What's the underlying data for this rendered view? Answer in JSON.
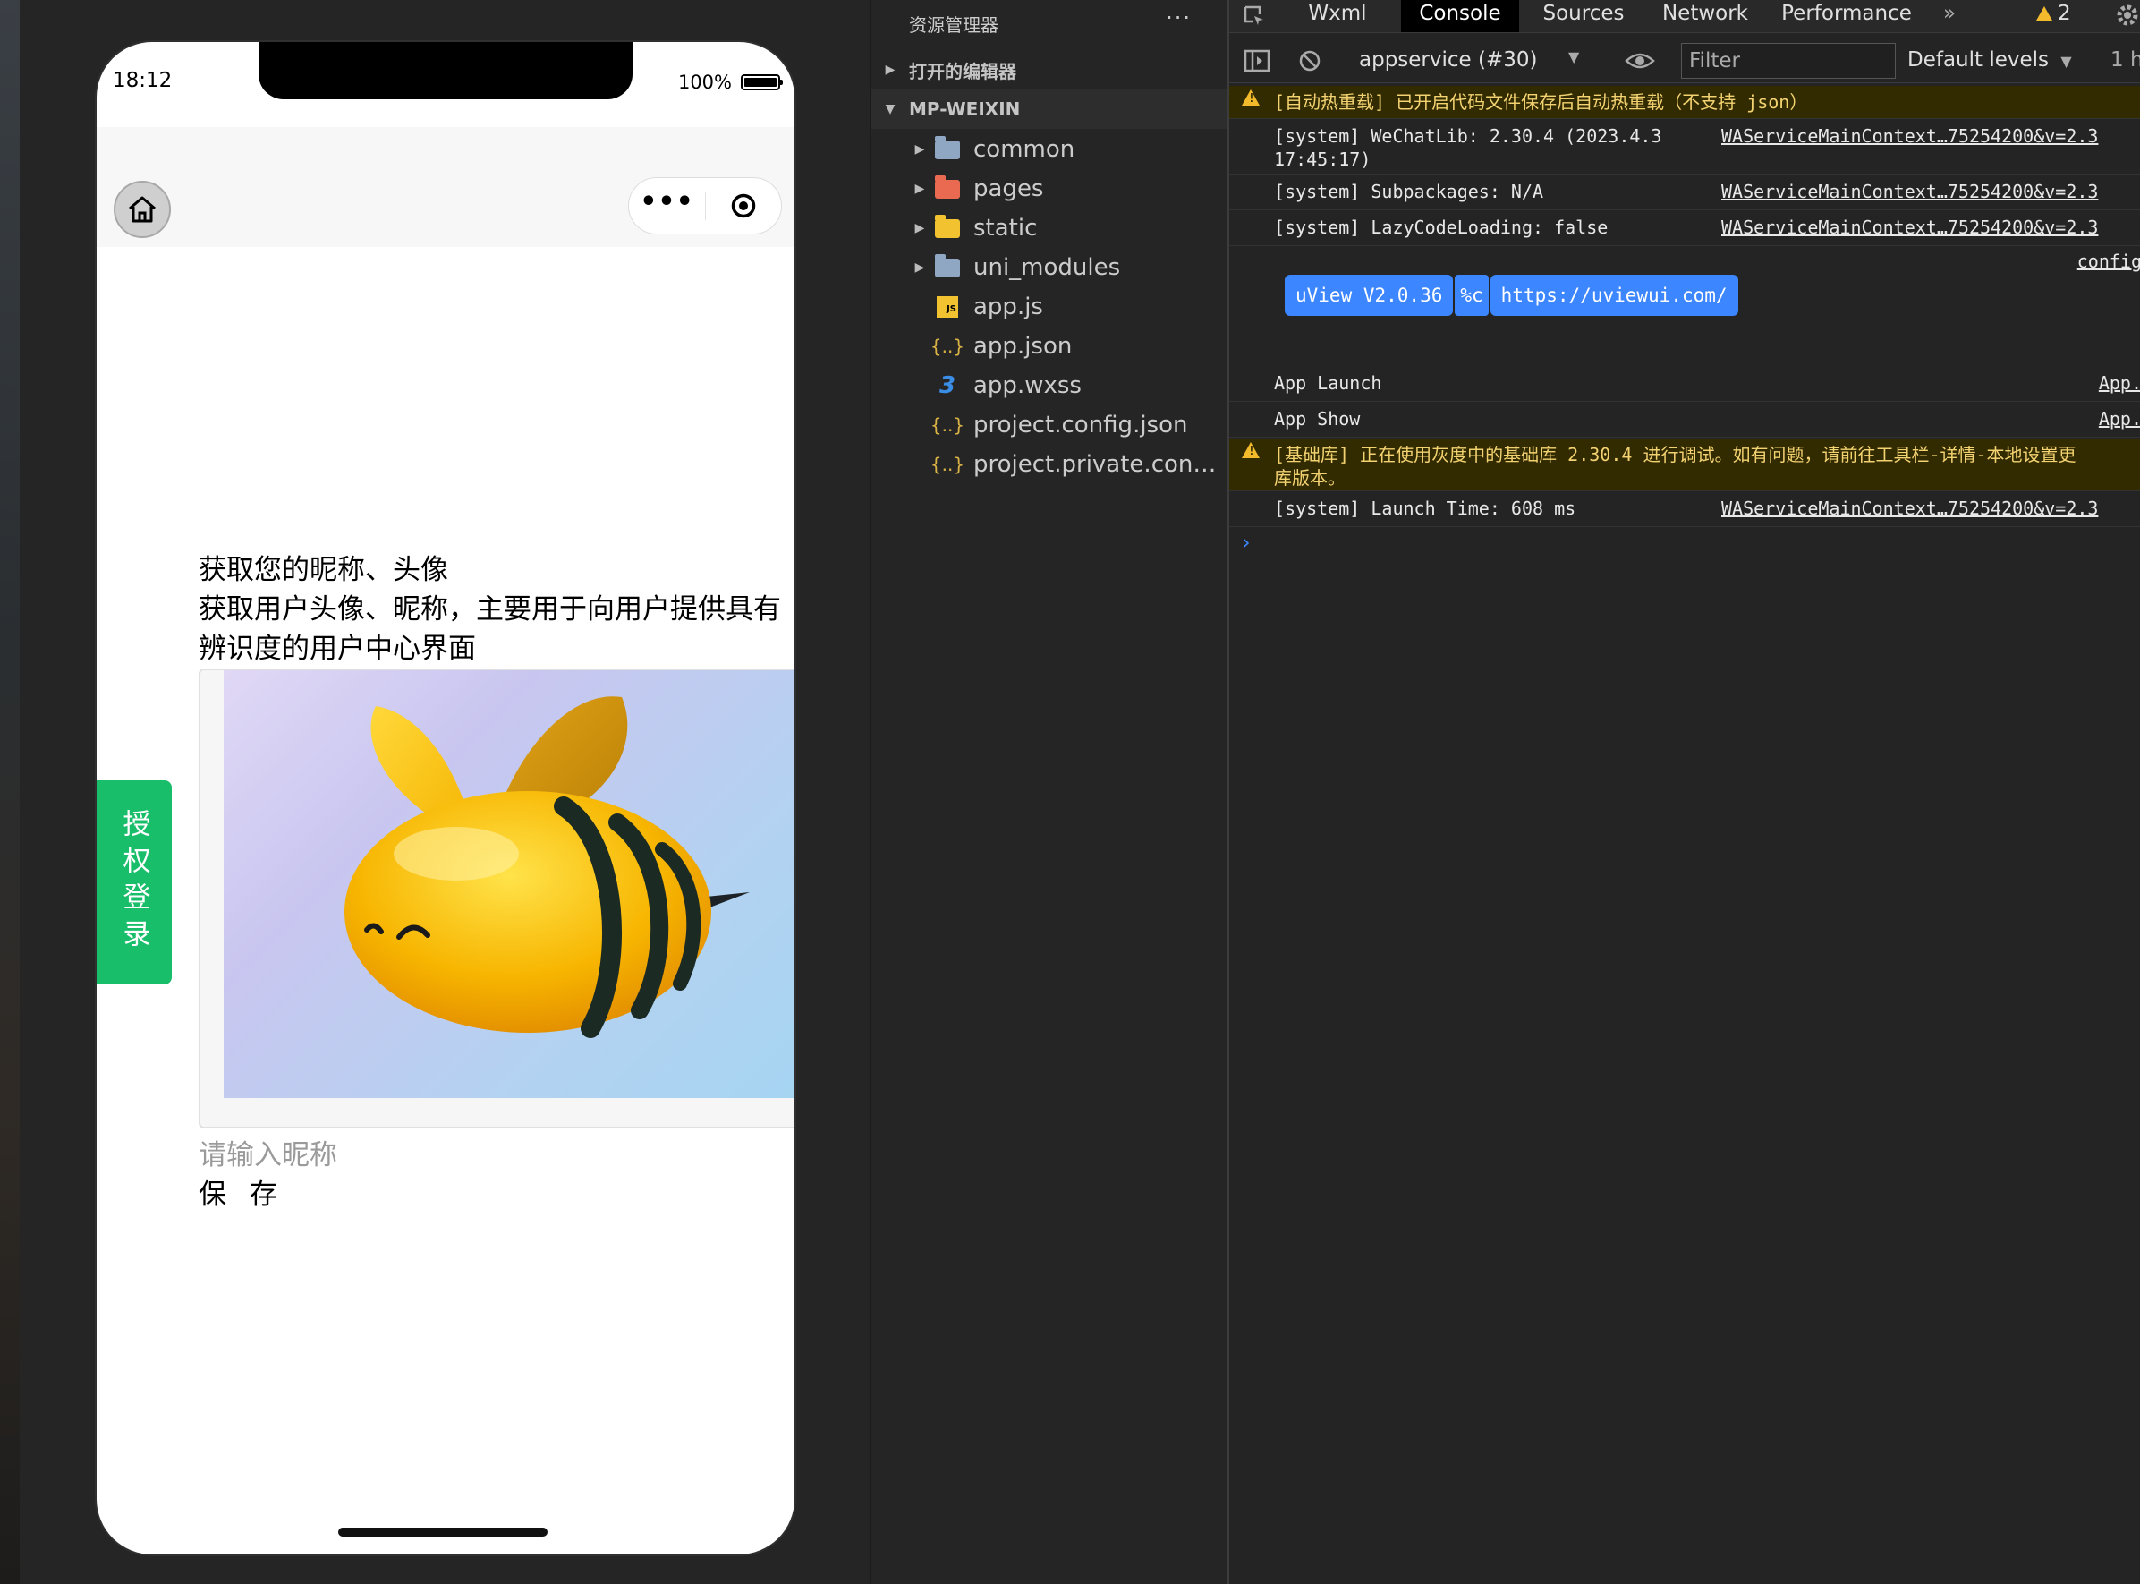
{
  "phone": {
    "time": "18:12",
    "battery": "100%",
    "auth_tab": "授权登录",
    "heading": "获取您的昵称、头像",
    "description": "获取用户头像、昵称，主要用于向用户提供具有辨识度的用户中心界面",
    "nickname_placeholder": "请输入昵称",
    "save_label": "保 存"
  },
  "explorer": {
    "title": "资源管理器",
    "more": "···",
    "open_editors": "打开的编辑器",
    "project": "MP-WEIXIN",
    "items": [
      {
        "name": "common",
        "icon": "folder-icon",
        "color": "#8fa7c3"
      },
      {
        "name": "pages",
        "icon": "folder-pages-icon",
        "color": "#e96a51"
      },
      {
        "name": "static",
        "icon": "folder-static-icon",
        "color": "#f2c230"
      },
      {
        "name": "uni_modules",
        "icon": "folder-icon",
        "color": "#8fa7c3"
      },
      {
        "name": "app.js",
        "icon": "js-file-icon",
        "color": "#f2c230"
      },
      {
        "name": "app.json",
        "icon": "json-file-icon",
        "color": "#d9b345"
      },
      {
        "name": "app.wxss",
        "icon": "css-file-icon",
        "color": "#3a8ee6"
      },
      {
        "name": "project.config.json",
        "icon": "json-file-icon",
        "color": "#d9b345"
      },
      {
        "name": "project.private.config...",
        "icon": "json-file-icon",
        "color": "#d9b345"
      }
    ]
  },
  "devtools": {
    "tabs": [
      "Wxml",
      "Console",
      "Sources",
      "Network",
      "Performance"
    ],
    "more_tabs": "»",
    "warning_count": "2",
    "context": "appservice (#30)",
    "filter_placeholder": "Filter",
    "levels": "Default levels",
    "issues": "1 h",
    "logs": [
      {
        "type": "warn",
        "msg": "[自动热重载] 已开启代码文件保存后自动热重载（不支持 json）",
        "src": ""
      },
      {
        "type": "log",
        "msg": "[system] WeChatLib: 2.30.4 (2023.4.3\n17:45:17)",
        "src": "WAServiceMainContext…75254200&v=2.3"
      },
      {
        "type": "log",
        "msg": "[system] Subpackages: N/A",
        "src": "WAServiceMainContext…75254200&v=2.3"
      },
      {
        "type": "log",
        "msg": "[system] LazyCodeLoading: false",
        "src": "WAServiceMainContext…75254200&v=2.3"
      },
      {
        "type": "log",
        "msg": "App Launch",
        "src": "App."
      },
      {
        "type": "log",
        "msg": "App Show",
        "src": "App."
      },
      {
        "type": "warn",
        "msg": "[基础库] 正在使用灰度中的基础库 2.30.4 进行调试。如有问题，请前往工具栏-详情-本地设置更\n库版本。",
        "src": ""
      },
      {
        "type": "log",
        "msg": "[system] Launch Time: 608 ms",
        "src": "WAServiceMainContext…75254200&v=2.3"
      }
    ],
    "config_link": "config",
    "uview_badge": "uView V2.0.36",
    "uview_mid": "%c",
    "uview_url": "https://uviewui.com/",
    "prompt": "›"
  }
}
